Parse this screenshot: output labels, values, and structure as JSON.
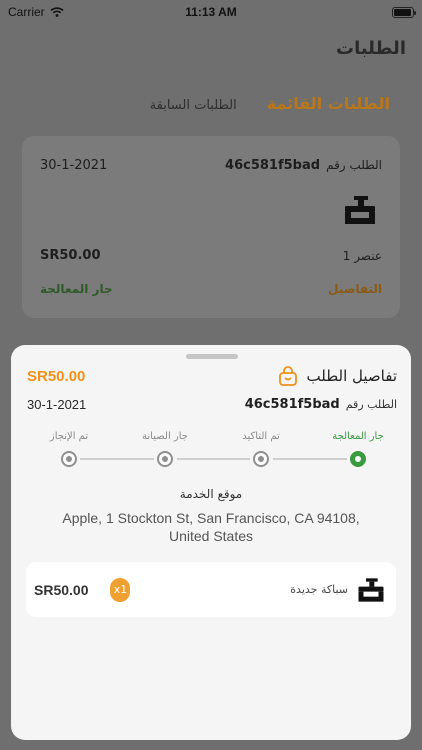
{
  "status_bar": {
    "carrier": "Carrier",
    "time": "11:13 AM",
    "battery_level": 0.95
  },
  "page": {
    "title": "الطلبات",
    "tabs": [
      {
        "label": "الطلبات القائمة",
        "active": true
      },
      {
        "label": "الطلبات السابقة",
        "active": false
      }
    ]
  },
  "order_card": {
    "order_label": "الطلب رقم",
    "order_id": "46c581f5bad",
    "date": "30-1-2021",
    "price": "SR50.00",
    "quantity_text": "1 عنصر",
    "details_label": "التفاصيل",
    "status": "جار المعالجة",
    "icon": "pipe-faucet-icon"
  },
  "sheet": {
    "title": "تفاصيل الطلب",
    "title_icon": "shopping-bag-icon",
    "price": "SR50.00",
    "order_label": "الطلب رقم",
    "order_id": "46c581f5bad",
    "date": "30-1-2021",
    "steps": [
      {
        "label": "جار المعالجة",
        "active": true
      },
      {
        "label": "تم التاكيد",
        "active": false
      },
      {
        "label": "جار الصيانة",
        "active": false
      },
      {
        "label": "تم الإنجاز",
        "active": false
      }
    ],
    "location_title": "موقع الخدمة",
    "location_address": "Apple, 1 Stockton St, San Francisco, CA  94108, United States",
    "item": {
      "name": "سباكة جديدة",
      "quantity": "x1",
      "price": "SR50.00",
      "icon": "pipe-faucet-icon"
    }
  },
  "colors": {
    "accent": "#f09119",
    "success": "#3a9a3e",
    "overlay": "#6f6f6f",
    "sheet": "#f5f5f5"
  }
}
